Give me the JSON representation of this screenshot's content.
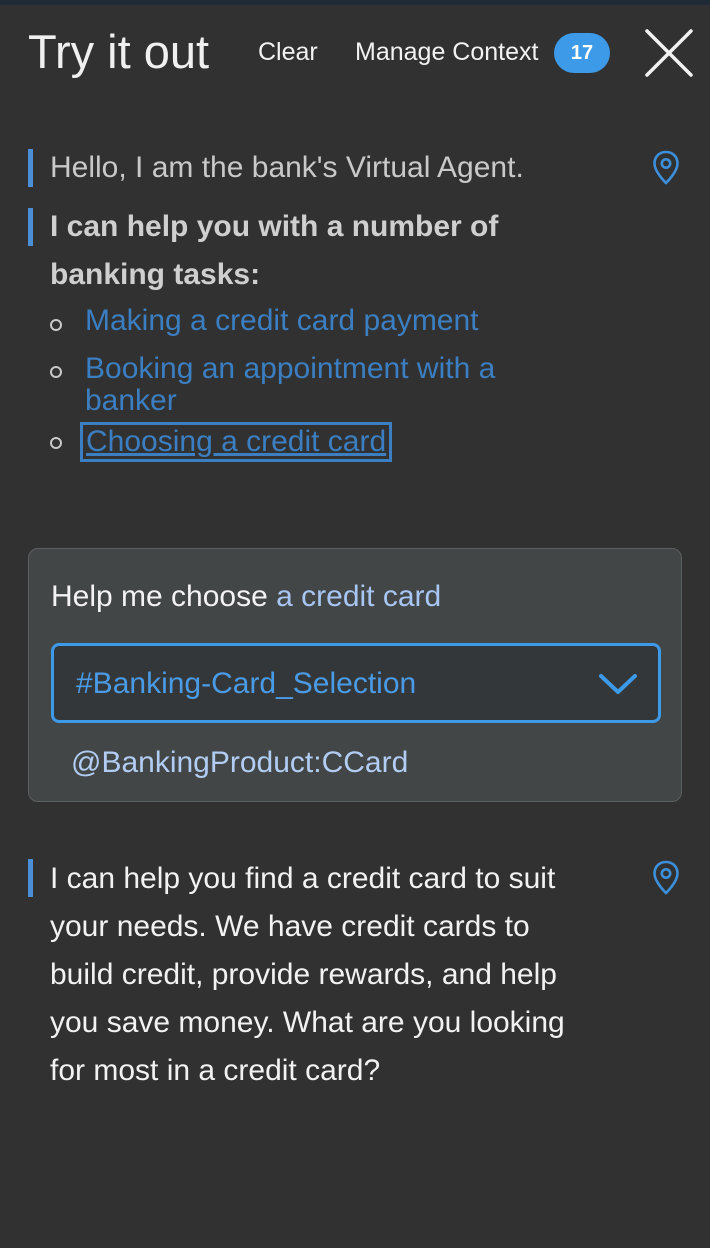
{
  "header": {
    "title": "Try it out",
    "clear_label": "Clear",
    "manage_context_label": "Manage Context",
    "context_count": "17",
    "close_icon": "close-icon"
  },
  "conversation": {
    "greeting": "Hello, I am the bank's Virtual Agent.",
    "help_intro_line1": "I can help you with a number of",
    "help_intro_line2": "banking tasks:",
    "options": [
      {
        "label": "Making a credit card payment"
      },
      {
        "label_line1": "Booking an appointment with a",
        "label_line2": "banker"
      },
      {
        "label": "Choosing a credit card"
      }
    ],
    "user_message": {
      "prefix": "Help me choose ",
      "entity_text": "a credit card",
      "intent": "#Banking-Card_Selection",
      "entity": "@BankingProduct:CCard"
    },
    "reply_lines": [
      "I can help you find a credit card to suit",
      "your needs. We have credit cards to",
      "build credit, provide rewards, and help",
      "you save money. What are you looking",
      "for most in a credit card?"
    ]
  },
  "icons": {
    "location": "location-pin-icon",
    "dropdown": "chevron-down-icon"
  },
  "colors": {
    "background": "#313131",
    "accent": "#3d9ae8",
    "link": "#3b7fc2",
    "entity": "#a8c6f3"
  }
}
